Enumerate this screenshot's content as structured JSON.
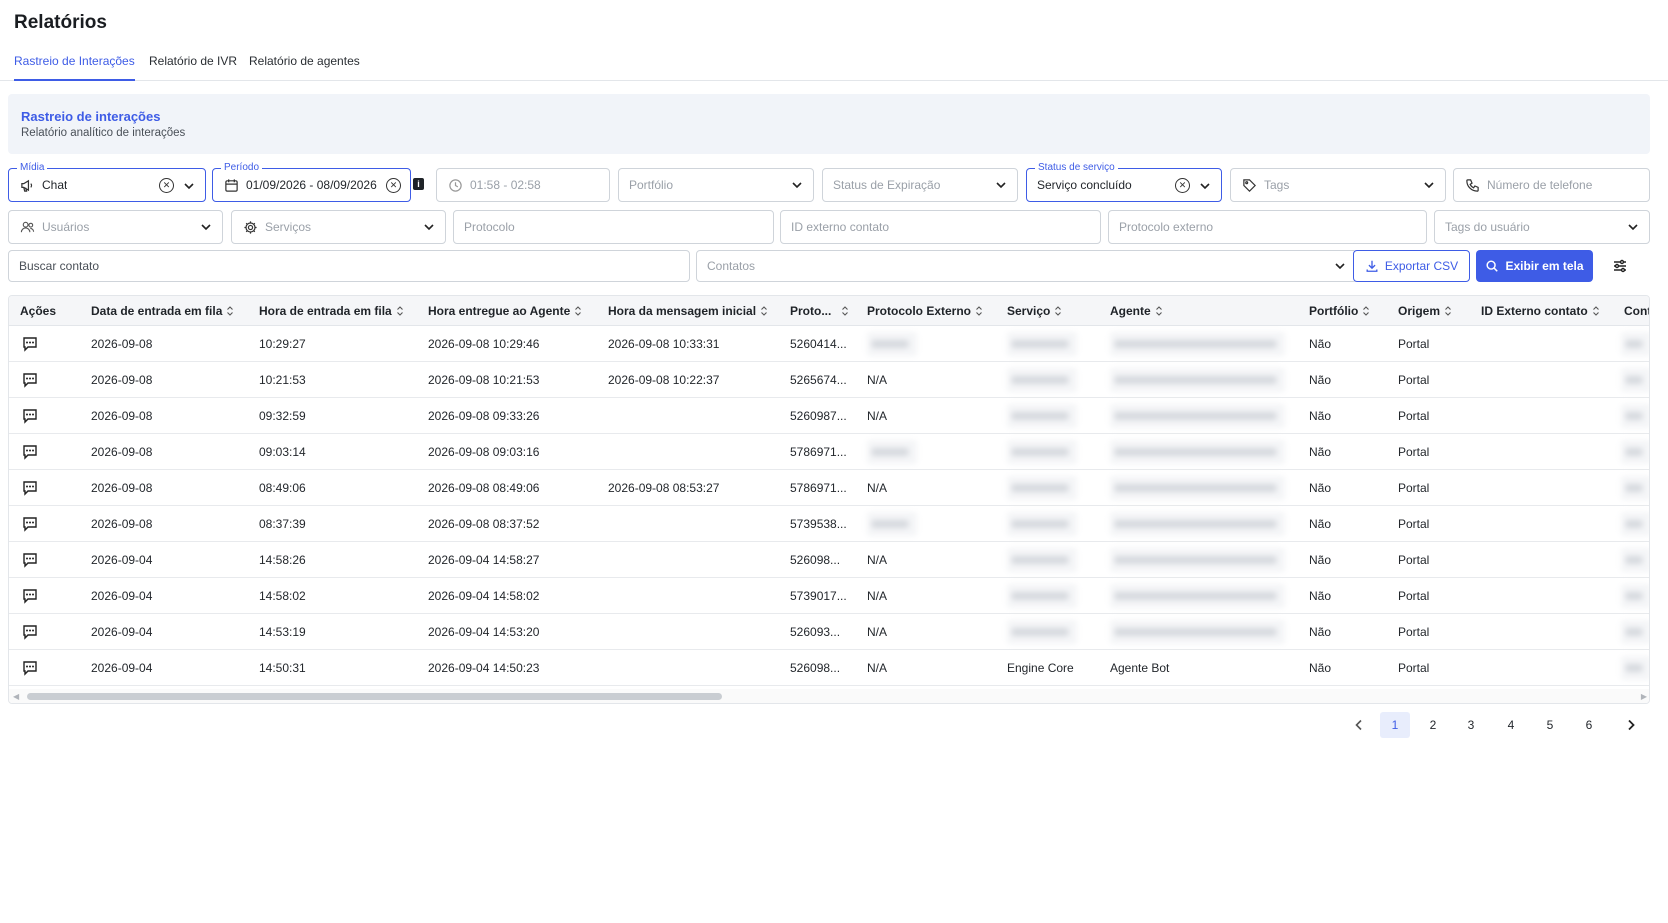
{
  "page": {
    "title": "Relatórios"
  },
  "tabs": [
    {
      "label": "Rastreio de Interações",
      "active": true
    },
    {
      "label": "Relatório de IVR",
      "active": false
    },
    {
      "label": "Relatório de agentes",
      "active": false
    }
  ],
  "banner": {
    "title": "Rastreio de interações",
    "subtitle": "Relatório analítico de interações"
  },
  "filters": {
    "midia": {
      "legend": "Mídia",
      "value": "Chat"
    },
    "periodo": {
      "legend": "Período",
      "value": "01/09/2026 - 08/09/2026",
      "info_badge": "i"
    },
    "hora": {
      "placeholder": "01:58 - 02:58"
    },
    "portfolio": {
      "placeholder": "Portfólio"
    },
    "status_expiracao": {
      "placeholder": "Status de Expiração"
    },
    "status_servico": {
      "legend": "Status de serviço",
      "value": "Serviço concluído"
    },
    "tags": {
      "placeholder": "Tags"
    },
    "telefone": {
      "placeholder": "Número de telefone"
    },
    "usuarios": {
      "placeholder": "Usuários"
    },
    "servicos": {
      "placeholder": "Serviços"
    },
    "protocolo": {
      "placeholder": "Protocolo"
    },
    "id_externo": {
      "placeholder": "ID externo contato"
    },
    "protocolo_externo": {
      "placeholder": "Protocolo externo"
    },
    "tags_usuario": {
      "placeholder": "Tags do usuário"
    },
    "buscar_contato": {
      "placeholder": "Buscar contato"
    },
    "contatos": {
      "placeholder": "Contatos"
    }
  },
  "actions": {
    "export_label": "Exportar CSV",
    "show_label": "Exibir em tela"
  },
  "table": {
    "columns": [
      "Ações",
      "Data de entrada em fila",
      "Hora de entrada em fila",
      "Hora entregue ao Agente",
      "Hora da mensagem inicial",
      "Proto...",
      "Protocolo Externo",
      "Serviço",
      "Agente",
      "Portfólio",
      "Origem",
      "ID Externo contato",
      "Cont"
    ],
    "rows": [
      {
        "data": "2026-09-08",
        "hora_fila": "10:29:27",
        "hora_agente": "2026-09-08 10:29:46",
        "hora_msg": "2026-09-08 10:33:31",
        "proto": "5260414...",
        "proto_ext": "",
        "servico": "",
        "agente": "",
        "portfolio": "Não",
        "origem": "Portal"
      },
      {
        "data": "2026-09-08",
        "hora_fila": "10:21:53",
        "hora_agente": "2026-09-08 10:21:53",
        "hora_msg": "2026-09-08 10:22:37",
        "proto": "5265674...",
        "proto_ext": "N/A",
        "servico": "",
        "agente": "",
        "portfolio": "Não",
        "origem": "Portal"
      },
      {
        "data": "2026-09-08",
        "hora_fila": "09:32:59",
        "hora_agente": "2026-09-08 09:33:26",
        "hora_msg": "",
        "proto": "5260987...",
        "proto_ext": "N/A",
        "servico": "",
        "agente": "",
        "portfolio": "Não",
        "origem": "Portal"
      },
      {
        "data": "2026-09-08",
        "hora_fila": "09:03:14",
        "hora_agente": "2026-09-08 09:03:16",
        "hora_msg": "",
        "proto": "5786971...",
        "proto_ext": "",
        "servico": "",
        "agente": "",
        "portfolio": "Não",
        "origem": "Portal"
      },
      {
        "data": "2026-09-08",
        "hora_fila": "08:49:06",
        "hora_agente": "2026-09-08 08:49:06",
        "hora_msg": "2026-09-08 08:53:27",
        "proto": "5786971...",
        "proto_ext": "N/A",
        "servico": "",
        "agente": "",
        "portfolio": "Não",
        "origem": "Portal"
      },
      {
        "data": "2026-09-08",
        "hora_fila": "08:37:39",
        "hora_agente": "2026-09-08 08:37:52",
        "hora_msg": "",
        "proto": "5739538...",
        "proto_ext": "",
        "servico": "",
        "agente": "",
        "portfolio": "Não",
        "origem": "Portal"
      },
      {
        "data": "2026-09-04",
        "hora_fila": "14:58:26",
        "hora_agente": "2026-09-04 14:58:27",
        "hora_msg": "",
        "proto": "526098...",
        "proto_ext": "N/A",
        "servico": "",
        "agente": "",
        "portfolio": "Não",
        "origem": "Portal"
      },
      {
        "data": "2026-09-04",
        "hora_fila": "14:58:02",
        "hora_agente": "2026-09-04 14:58:02",
        "hora_msg": "",
        "proto": "5739017...",
        "proto_ext": "N/A",
        "servico": "",
        "agente": "",
        "portfolio": "Não",
        "origem": "Portal"
      },
      {
        "data": "2026-09-04",
        "hora_fila": "14:53:19",
        "hora_agente": "2026-09-04 14:53:20",
        "hora_msg": "",
        "proto": "526093...",
        "proto_ext": "N/A",
        "servico": "",
        "agente": "",
        "portfolio": "Não",
        "origem": "Portal"
      },
      {
        "data": "2026-09-04",
        "hora_fila": "14:50:31",
        "hora_agente": "2026-09-04 14:50:23",
        "hora_msg": "",
        "proto": "526098...",
        "proto_ext": "N/A",
        "servico": "Engine Core",
        "agente": "Agente Bot",
        "portfolio": "Não",
        "origem": "Portal"
      }
    ]
  },
  "pagination": {
    "pages": [
      "1",
      "2",
      "3",
      "4",
      "5",
      "6"
    ],
    "current": "1"
  },
  "colors": {
    "accent": "#3e5ce6",
    "banner_bg": "#f1f4f9"
  },
  "icons": [
    "megaphone-icon",
    "calendar-icon",
    "clock-icon",
    "tag-icon",
    "phone-icon",
    "users-icon",
    "gear-icon",
    "download-icon",
    "search-icon",
    "sliders-icon",
    "chat-icon"
  ]
}
